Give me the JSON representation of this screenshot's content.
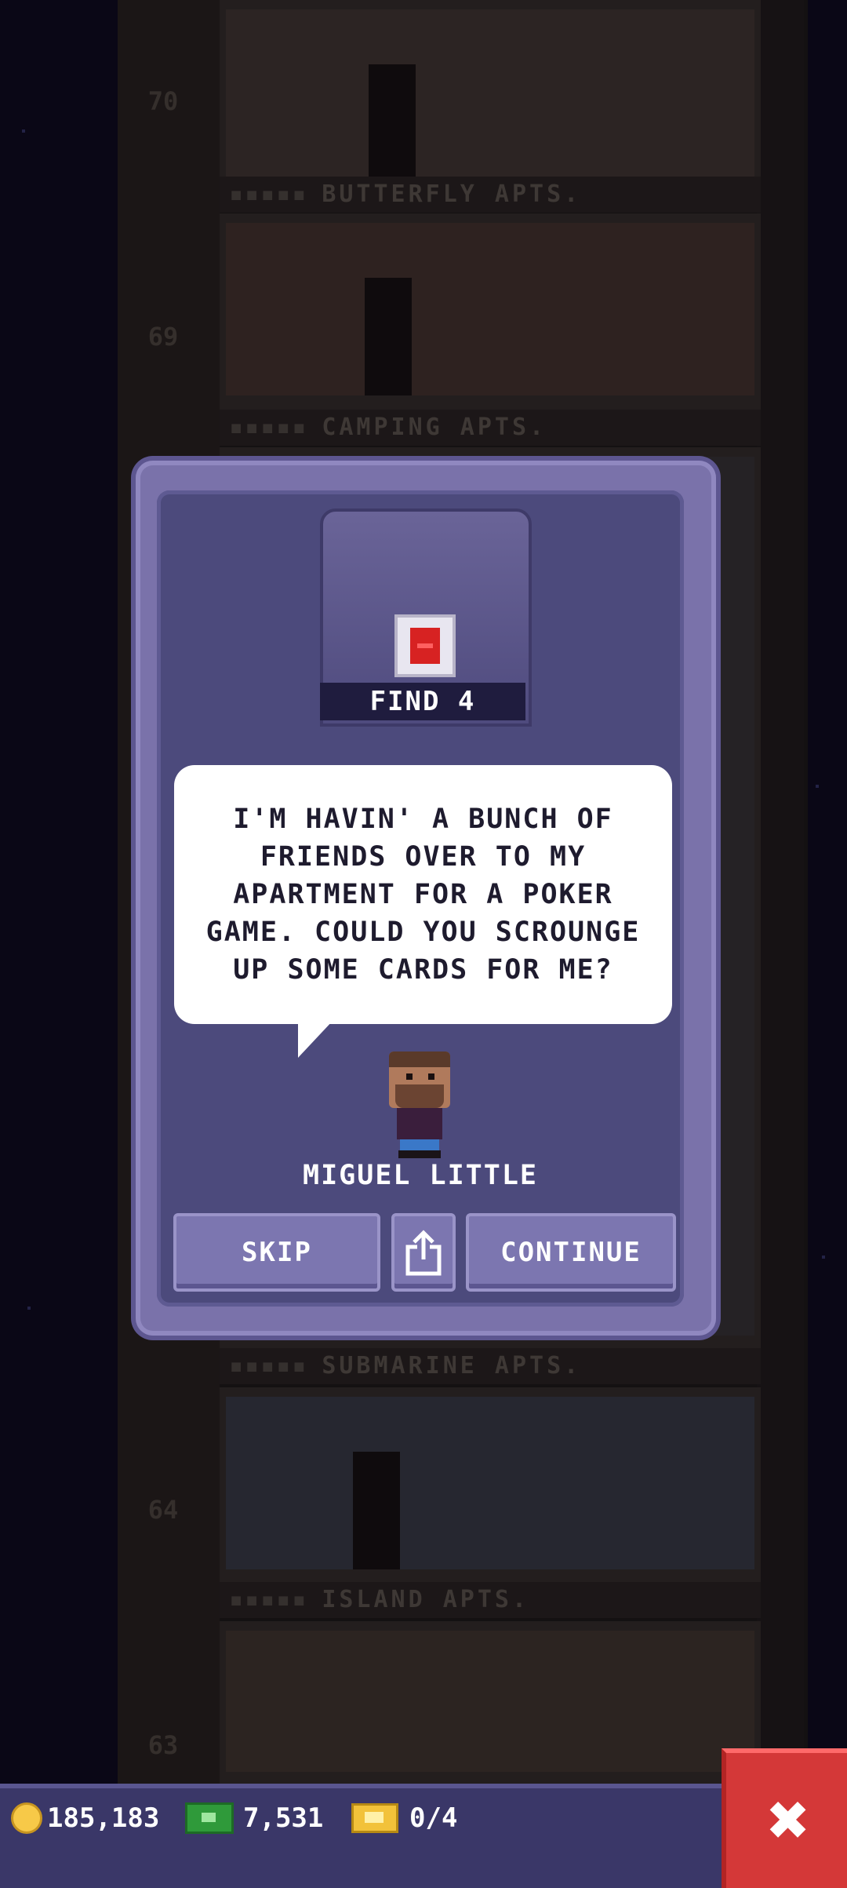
{
  "background": {
    "floors": [
      {
        "number": "70",
        "label": "BUTTERFLY APTS."
      },
      {
        "number": "69",
        "label": "CAMPING APTS."
      },
      {
        "number": "64",
        "label": "SUBMARINE APTS."
      },
      {
        "number": "63",
        "label": "ISLAND APTS."
      }
    ],
    "label_dots": "▪▪▪▪▪"
  },
  "quest": {
    "objective": "FIND 4",
    "message": "I'M HAVIN' A BUNCH OF FRIENDS OVER TO MY APARTMENT FOR A POKER GAME. COULD YOU SCROUNGE UP SOME CARDS FOR ME?",
    "character_name": "MIGUEL LITTLE",
    "item_icon": "playing-card-icon"
  },
  "buttons": {
    "skip": "SKIP",
    "share_icon": "share-icon",
    "continue": "CONTINUE"
  },
  "resources": {
    "coins": "185,183",
    "bux": "7,531",
    "tickets": "0/4"
  },
  "close_icon": "close-icon",
  "colors": {
    "modal_frame": "#7a72aa",
    "modal_body": "#4c4a7c",
    "button": "#7c76b0",
    "close_button": "#d43838",
    "bottom_bar": "#3a3768"
  }
}
